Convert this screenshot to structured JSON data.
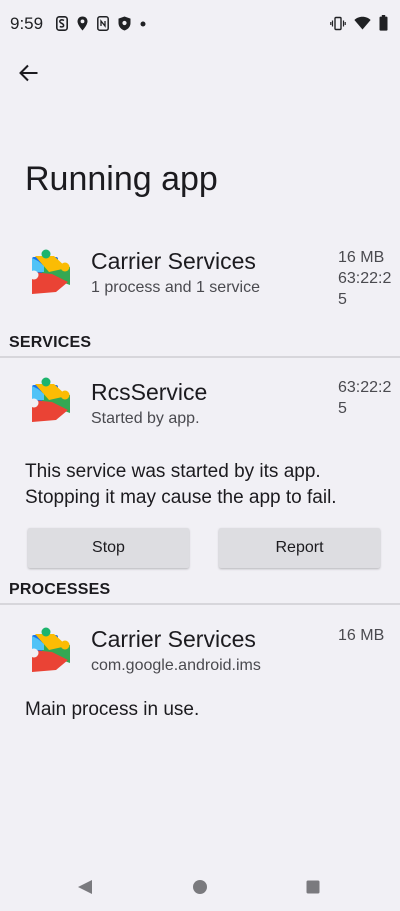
{
  "status_bar": {
    "time": "9:59",
    "left_icons": [
      "s-notification-icon",
      "location-icon",
      "nfc-icon",
      "shield-icon",
      "dot-icon"
    ],
    "right_icons": [
      "vibrate-icon",
      "wifi-icon",
      "battery-icon"
    ]
  },
  "page": {
    "title": "Running app"
  },
  "app": {
    "name": "Carrier Services",
    "summary": "1 process and 1 service",
    "memory": "16 MB",
    "time_line1": "63:22:2",
    "time_line2": "5"
  },
  "services": {
    "header": "SERVICES",
    "item": {
      "name": "RcsService",
      "subtitle": "Started by app.",
      "time_line1": "63:22:2",
      "time_line2": "5"
    },
    "description_line1": "This service was started by its app.",
    "description_line2": "Stopping it may cause the app to fail.",
    "stop_label": "Stop",
    "report_label": "Report"
  },
  "processes": {
    "header": "PROCESSES",
    "item": {
      "name": "Carrier Services",
      "package": "com.google.android.ims",
      "memory": "16 MB"
    },
    "description": "Main process in use."
  },
  "colors": {
    "background": "#f1f0f5",
    "button": "#dddde1",
    "divider": "#d7d6db"
  }
}
